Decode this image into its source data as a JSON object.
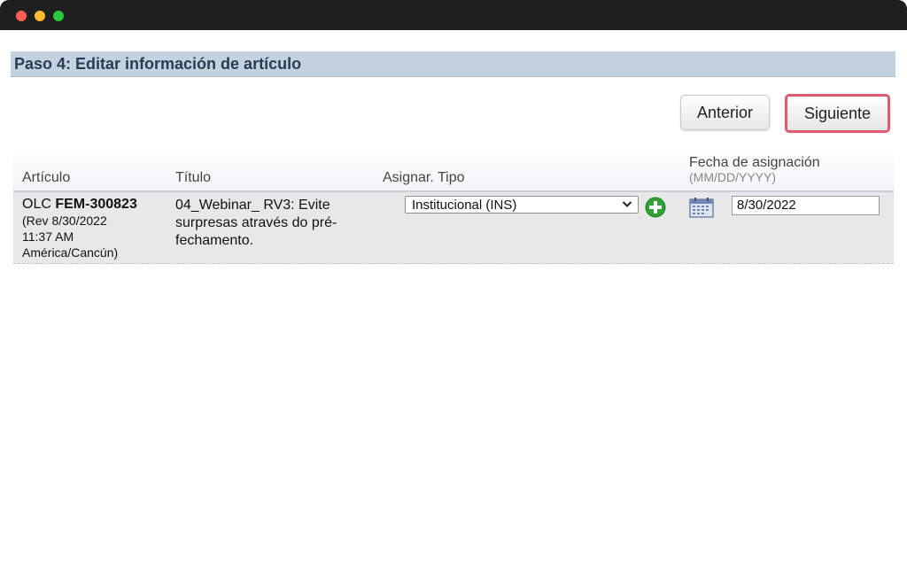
{
  "window": {
    "controls": [
      "close",
      "minimize",
      "maximize"
    ]
  },
  "header": {
    "title": "Paso 4: Editar información de artículo"
  },
  "toolbar": {
    "prev_label": "Anterior",
    "next_label": "Siguiente"
  },
  "table": {
    "columns": {
      "articulo": "Artículo",
      "titulo": "Título",
      "tipo": "Asignar. Tipo",
      "fecha": "Fecha de asignación",
      "fecha_format": "(MM/DD/YYYY)"
    },
    "rows": [
      {
        "articulo_prefix": "OLC ",
        "articulo_code": "FEM-300823",
        "articulo_rev_line1": "(Rev 8/30/2022",
        "articulo_rev_line2": "11:37 AM",
        "articulo_rev_line3": "América/Cancún)",
        "titulo": "04_Webinar_ RV3: Evite surpresas através do pré-fechamento.",
        "tipo_selected": "Institucional (INS)",
        "fecha_value": "8/30/2022"
      }
    ]
  },
  "icons": {
    "add": "add-plus-circle-icon",
    "calendar": "calendar-icon",
    "dropdown": "chevron-down-icon"
  },
  "colors": {
    "header_band": "#c4d1df",
    "header_text": "#2b3a56",
    "highlight_border": "#e05a74",
    "add_icon": "#2fa335"
  }
}
